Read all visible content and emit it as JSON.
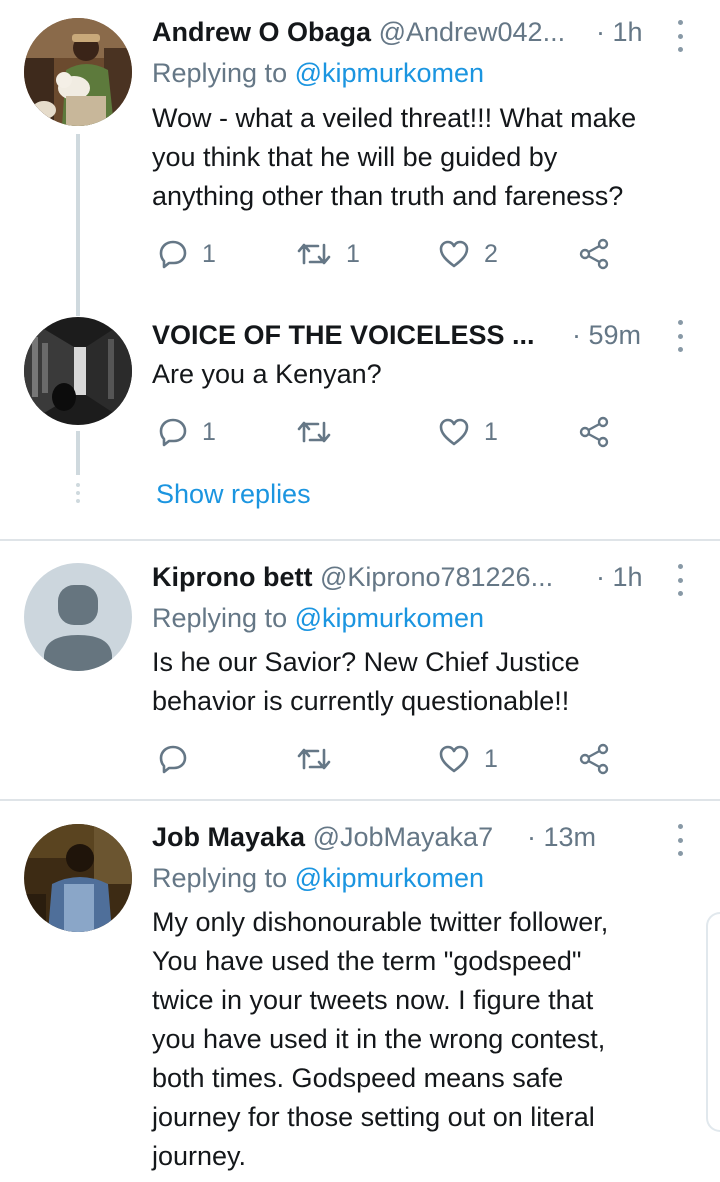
{
  "tweets": [
    {
      "name": "Andrew O Obaga",
      "handle": "@Andrew042...",
      "time": "· 1h",
      "replying_label": "Replying to",
      "replying_to": "@kipmurkomen",
      "text": "Wow - what a veiled threat!!! What make\nyou think that he will be guided by\nanything other than truth and fareness?",
      "reply_count": "1",
      "retweet_count": "1",
      "like_count": "2"
    },
    {
      "name": "VOICE OF THE VOICELESS ...",
      "handle": "",
      "time": "· 59m",
      "text": "Are you a Kenyan?",
      "reply_count": "1",
      "retweet_count": "",
      "like_count": "1"
    },
    {
      "name": "Kiprono bett",
      "handle": "@Kiprono781226...",
      "time": "· 1h",
      "replying_label": "Replying to",
      "replying_to": "@kipmurkomen",
      "text": "Is he our Savior? New Chief Justice\nbehavior is currently questionable!!",
      "reply_count": "",
      "retweet_count": "",
      "like_count": "1"
    },
    {
      "name": "Job Mayaka",
      "handle": "@JobMayaka7",
      "time": "· 13m",
      "replying_label": "Replying to",
      "replying_to": "@kipmurkomen",
      "text": "My only dishonourable twitter follower,\nYou have used the term \"godspeed\"\ntwice in your tweets now. I figure that\nyou have used it in the wrong contest,\nboth times. Godspeed means safe\njourney for those setting out on literal\njourney."
    }
  ],
  "show_replies": "Show replies",
  "icons": {
    "reply": "reply-icon",
    "retweet": "retweet-icon",
    "like": "heart-icon",
    "share": "share-icon",
    "more": "more-vertical-icon"
  },
  "colors": {
    "link": "#1b95e0",
    "secondary_text": "#657786",
    "icon": "#657786",
    "divider": "#dfe4e8"
  }
}
